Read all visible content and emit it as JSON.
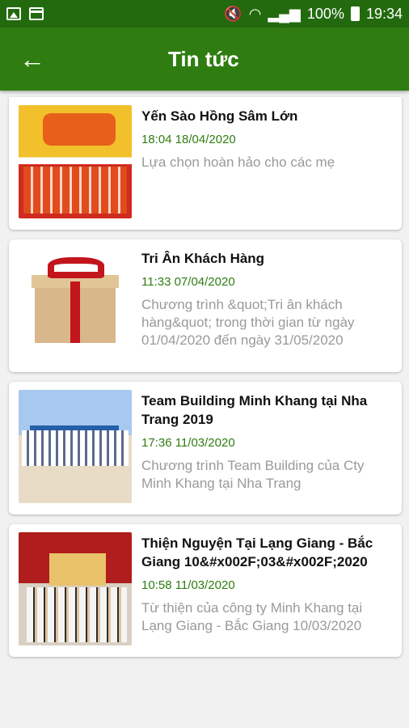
{
  "status_bar": {
    "battery": "100%",
    "time": "19:34"
  },
  "app_bar": {
    "back_icon": "arrow-back-icon",
    "title": "Tin tức"
  },
  "news": [
    {
      "title": "Yến Sào Hồng Sâm Lớn",
      "date": "18:04 18/04/2020",
      "desc": "Lựa chọn hoàn hảo cho các mẹ"
    },
    {
      "title": "Tri Ân Khách Hàng",
      "date": "11:33 07/04/2020",
      "desc": "Chương trình &quot;Tri ân khách hàng&quot; trong thời gian từ ngày 01/04/2020 đến ngày 31/05/2020"
    },
    {
      "title": "Team Building Minh Khang tại Nha Trang 2019",
      "date": "17:36 11/03/2020",
      "desc": "Chương trình Team Building của Cty Minh Khang tại Nha Trang"
    },
    {
      "title": "Thiện Nguyện Tại Lạng Giang - Bắc Giang 10&#x002F;03&#x002F;2020",
      "date": "10:58 11/03/2020",
      "desc": "Từ thiện của công ty Minh Khang tại Lạng Giang - Bắc Giang 10/03/2020"
    }
  ],
  "colors": {
    "status_bar": "#236a0f",
    "app_bar": "#2f7d11",
    "date_text": "#2f7d11"
  }
}
